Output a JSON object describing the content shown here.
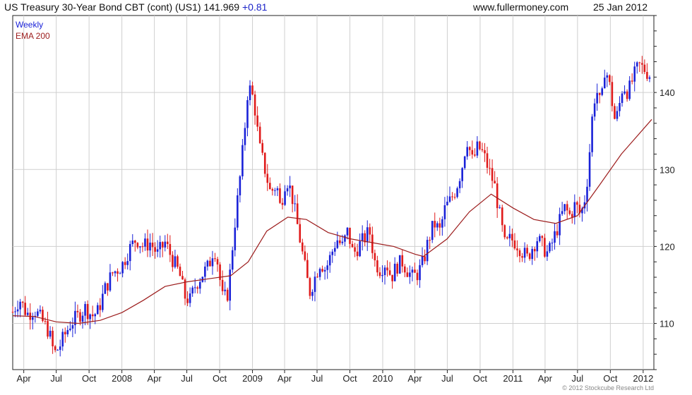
{
  "header": {
    "title": "US Treasury 30-Year  Bond CBT (cont) (US1) 141.969",
    "change": "+0.81",
    "website": "www.fullermoney.com",
    "date": "25 Jan 2012"
  },
  "footer": "© 2012 Stockcube Research Ltd",
  "colors": {
    "up": "#1a22d8",
    "down": "#e01a1a",
    "ema": "#9c1c1c",
    "grid": "#cfcfcf",
    "axis": "#222222"
  },
  "chart_data": {
    "type": "line",
    "title": "US Treasury 30-Year  Bond CBT (cont) (US1) 141.969",
    "legend": [
      "Weekly",
      "EMA 200"
    ],
    "legend_position": "top-left",
    "grid": true,
    "yaxis_side": "right",
    "ylim": [
      104,
      150
    ],
    "yticks": [
      110,
      120,
      130,
      140
    ],
    "xlim": [
      "2007-03-01",
      "2012-01-31"
    ],
    "xticks": [
      {
        "label": "Apr",
        "date": "2007-04-01"
      },
      {
        "label": "Jul",
        "date": "2007-07-01"
      },
      {
        "label": "Oct",
        "date": "2007-10-01"
      },
      {
        "label": "2008",
        "date": "2008-01-01"
      },
      {
        "label": "Apr",
        "date": "2008-04-01"
      },
      {
        "label": "Jul",
        "date": "2008-07-01"
      },
      {
        "label": "Oct",
        "date": "2008-10-01"
      },
      {
        "label": "2009",
        "date": "2009-01-01"
      },
      {
        "label": "Apr",
        "date": "2009-04-01"
      },
      {
        "label": "Jul",
        "date": "2009-07-01"
      },
      {
        "label": "Oct",
        "date": "2009-10-01"
      },
      {
        "label": "2010",
        "date": "2010-01-01"
      },
      {
        "label": "Apr",
        "date": "2010-04-01"
      },
      {
        "label": "Jul",
        "date": "2010-07-01"
      },
      {
        "label": "Oct",
        "date": "2010-10-01"
      },
      {
        "label": "2011",
        "date": "2011-01-01"
      },
      {
        "label": "Apr",
        "date": "2011-04-01"
      },
      {
        "label": "Jul",
        "date": "2011-07-01"
      },
      {
        "label": "Oct",
        "date": "2011-10-01"
      },
      {
        "label": "2012",
        "date": "2012-01-01"
      }
    ],
    "series": [
      {
        "name": "Weekly",
        "type": "candlestick",
        "close_points": [
          [
            "2007-03-01",
            111.5
          ],
          [
            "2007-03-20",
            113.2
          ],
          [
            "2007-04-10",
            111.2
          ],
          [
            "2007-05-01",
            111.8
          ],
          [
            "2007-05-20",
            110.5
          ],
          [
            "2007-06-10",
            109.0
          ],
          [
            "2007-06-25",
            106.0
          ],
          [
            "2007-07-10",
            107.0
          ],
          [
            "2007-07-25",
            108.5
          ],
          [
            "2007-08-10",
            110.0
          ],
          [
            "2007-09-01",
            111.0
          ],
          [
            "2007-09-20",
            112.0
          ],
          [
            "2007-10-10",
            111.0
          ],
          [
            "2007-10-25",
            111.5
          ],
          [
            "2007-11-15",
            114.5
          ],
          [
            "2007-12-05",
            116.5
          ],
          [
            "2008-01-01",
            117.5
          ],
          [
            "2008-01-20",
            119.5
          ],
          [
            "2008-02-10",
            121.0
          ],
          [
            "2008-03-01",
            120.0
          ],
          [
            "2008-03-20",
            120.5
          ],
          [
            "2008-04-10",
            119.0
          ],
          [
            "2008-05-01",
            120.5
          ],
          [
            "2008-05-20",
            118.5
          ],
          [
            "2008-06-10",
            116.5
          ],
          [
            "2008-06-25",
            113.5
          ],
          [
            "2008-07-10",
            113.0
          ],
          [
            "2008-07-25",
            115.0
          ],
          [
            "2008-08-15",
            116.5
          ],
          [
            "2008-09-01",
            117.5
          ],
          [
            "2008-09-15",
            120.0
          ],
          [
            "2008-09-25",
            118.0
          ],
          [
            "2008-10-10",
            113.0
          ],
          [
            "2008-10-25",
            114.0
          ],
          [
            "2008-11-10",
            122.0
          ],
          [
            "2008-11-25",
            128.0
          ],
          [
            "2008-12-08",
            134.0
          ],
          [
            "2008-12-20",
            141.0
          ],
          [
            "2009-01-05",
            139.0
          ],
          [
            "2009-01-20",
            133.0
          ],
          [
            "2009-02-05",
            130.0
          ],
          [
            "2009-02-20",
            127.0
          ],
          [
            "2009-03-10",
            128.0
          ],
          [
            "2009-03-20",
            125.0
          ],
          [
            "2009-04-05",
            129.0
          ],
          [
            "2009-04-20",
            127.0
          ],
          [
            "2009-05-10",
            122.0
          ],
          [
            "2009-05-25",
            118.0
          ],
          [
            "2009-06-10",
            114.0
          ],
          [
            "2009-06-25",
            116.0
          ],
          [
            "2009-07-10",
            118.0
          ],
          [
            "2009-07-25",
            117.0
          ],
          [
            "2009-08-10",
            119.0
          ],
          [
            "2009-08-25",
            121.0
          ],
          [
            "2009-09-10",
            120.0
          ],
          [
            "2009-09-25",
            122.0
          ],
          [
            "2009-10-10",
            119.0
          ],
          [
            "2009-10-25",
            120.0
          ],
          [
            "2009-11-10",
            121.0
          ],
          [
            "2009-11-25",
            122.0
          ],
          [
            "2009-12-10",
            118.0
          ],
          [
            "2009-12-25",
            117.0
          ],
          [
            "2010-01-10",
            118.0
          ],
          [
            "2010-01-25",
            116.0
          ],
          [
            "2010-02-10",
            117.5
          ],
          [
            "2010-02-25",
            118.0
          ],
          [
            "2010-03-10",
            117.0
          ],
          [
            "2010-03-25",
            116.0
          ],
          [
            "2010-04-10",
            116.5
          ],
          [
            "2010-04-25",
            118.0
          ],
          [
            "2010-05-10",
            121.0
          ],
          [
            "2010-05-25",
            123.0
          ],
          [
            "2010-06-10",
            122.0
          ],
          [
            "2010-06-25",
            125.0
          ],
          [
            "2010-07-10",
            126.0
          ],
          [
            "2010-07-25",
            127.5
          ],
          [
            "2010-08-10",
            130.0
          ],
          [
            "2010-08-25",
            134.0
          ],
          [
            "2010-09-10",
            131.0
          ],
          [
            "2010-09-25",
            133.0
          ],
          [
            "2010-10-10",
            132.0
          ],
          [
            "2010-10-25",
            130.0
          ],
          [
            "2010-11-10",
            128.0
          ],
          [
            "2010-11-25",
            124.0
          ],
          [
            "2010-12-10",
            120.0
          ],
          [
            "2010-12-25",
            121.0
          ],
          [
            "2011-01-10",
            120.5
          ],
          [
            "2011-01-25",
            119.5
          ],
          [
            "2011-02-10",
            118.5
          ],
          [
            "2011-02-25",
            120.0
          ],
          [
            "2011-03-10",
            121.0
          ],
          [
            "2011-03-25",
            120.0
          ],
          [
            "2011-04-10",
            119.0
          ],
          [
            "2011-04-25",
            121.0
          ],
          [
            "2011-05-10",
            123.0
          ],
          [
            "2011-05-25",
            125.0
          ],
          [
            "2011-06-10",
            124.0
          ],
          [
            "2011-06-25",
            125.5
          ],
          [
            "2011-07-10",
            124.0
          ],
          [
            "2011-07-25",
            127.0
          ],
          [
            "2011-08-05",
            133.0
          ],
          [
            "2011-08-15",
            139.0
          ],
          [
            "2011-08-25",
            140.0
          ],
          [
            "2011-09-05",
            138.0
          ],
          [
            "2011-09-15",
            143.0
          ],
          [
            "2011-09-25",
            142.0
          ],
          [
            "2011-10-05",
            139.0
          ],
          [
            "2011-10-15",
            136.0
          ],
          [
            "2011-10-25",
            138.0
          ],
          [
            "2011-11-05",
            141.0
          ],
          [
            "2011-11-20",
            140.0
          ],
          [
            "2011-12-05",
            142.0
          ],
          [
            "2011-12-20",
            143.5
          ],
          [
            "2012-01-05",
            143.0
          ],
          [
            "2012-01-25",
            142.0
          ]
        ]
      },
      {
        "name": "EMA 200",
        "type": "line",
        "points": [
          [
            "2007-03-01",
            111.0
          ],
          [
            "2007-05-01",
            110.9
          ],
          [
            "2007-07-01",
            110.2
          ],
          [
            "2007-09-01",
            110.0
          ],
          [
            "2007-11-01",
            110.4
          ],
          [
            "2008-01-01",
            111.4
          ],
          [
            "2008-03-01",
            113.0
          ],
          [
            "2008-05-01",
            114.8
          ],
          [
            "2008-07-01",
            115.4
          ],
          [
            "2008-09-01",
            115.8
          ],
          [
            "2008-11-01",
            116.2
          ],
          [
            "2008-12-20",
            118.0
          ],
          [
            "2009-02-10",
            122.0
          ],
          [
            "2009-04-10",
            123.8
          ],
          [
            "2009-06-01",
            123.5
          ],
          [
            "2009-08-01",
            121.8
          ],
          [
            "2009-10-01",
            121.0
          ],
          [
            "2009-12-01",
            120.5
          ],
          [
            "2010-02-01",
            120.0
          ],
          [
            "2010-04-01",
            119.0
          ],
          [
            "2010-04-25",
            118.7
          ],
          [
            "2010-07-01",
            121.0
          ],
          [
            "2010-09-01",
            124.5
          ],
          [
            "2010-11-01",
            126.8
          ],
          [
            "2011-01-01",
            125.0
          ],
          [
            "2011-03-01",
            123.5
          ],
          [
            "2011-05-01",
            123.0
          ],
          [
            "2011-07-01",
            124.0
          ],
          [
            "2011-09-01",
            128.0
          ],
          [
            "2011-11-01",
            132.0
          ],
          [
            "2012-01-25",
            136.5
          ]
        ]
      }
    ]
  }
}
